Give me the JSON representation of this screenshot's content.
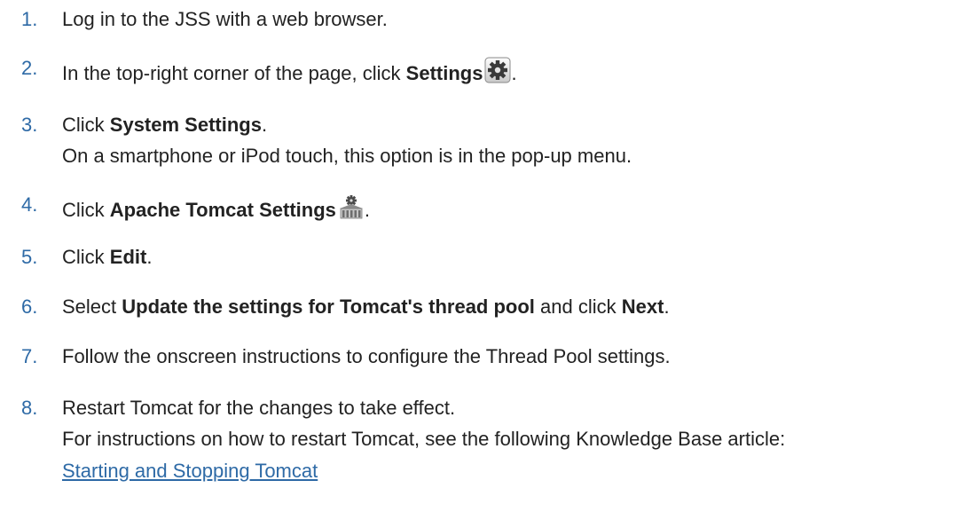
{
  "steps": [
    {
      "number": "1.",
      "text": "Log in to the JSS with a web browser."
    },
    {
      "number": "2.",
      "before": "In the top-right corner of the page, click ",
      "bold": "Settings",
      "after": ".",
      "icon": "settings-gear-icon"
    },
    {
      "number": "3.",
      "before": "Click ",
      "bold": "System Settings",
      "after": ".",
      "note": "On a smartphone or iPod touch, this option is in the pop-up menu."
    },
    {
      "number": "4.",
      "before": "Click ",
      "bold": "Apache Tomcat Settings",
      "after": ".",
      "icon": "apache-tomcat-settings-icon"
    },
    {
      "number": "5.",
      "before": "Click ",
      "bold": "Edit",
      "after": "."
    },
    {
      "number": "6.",
      "before": "Select ",
      "bold": "Update the settings for Tomcat's thread pool",
      "middle": " and click ",
      "bold2": "Next",
      "after": "."
    },
    {
      "number": "7.",
      "text": "Follow the onscreen instructions to configure the Thread Pool settings."
    },
    {
      "number": "8.",
      "text": "Restart Tomcat for the changes to take effect.",
      "note": "For instructions on how to restart Tomcat, see the following Knowledge Base article:",
      "link": "Starting and Stopping Tomcat"
    }
  ],
  "colors": {
    "number": "#2e6aa6",
    "link": "#2e6aa6",
    "text": "#222222"
  }
}
